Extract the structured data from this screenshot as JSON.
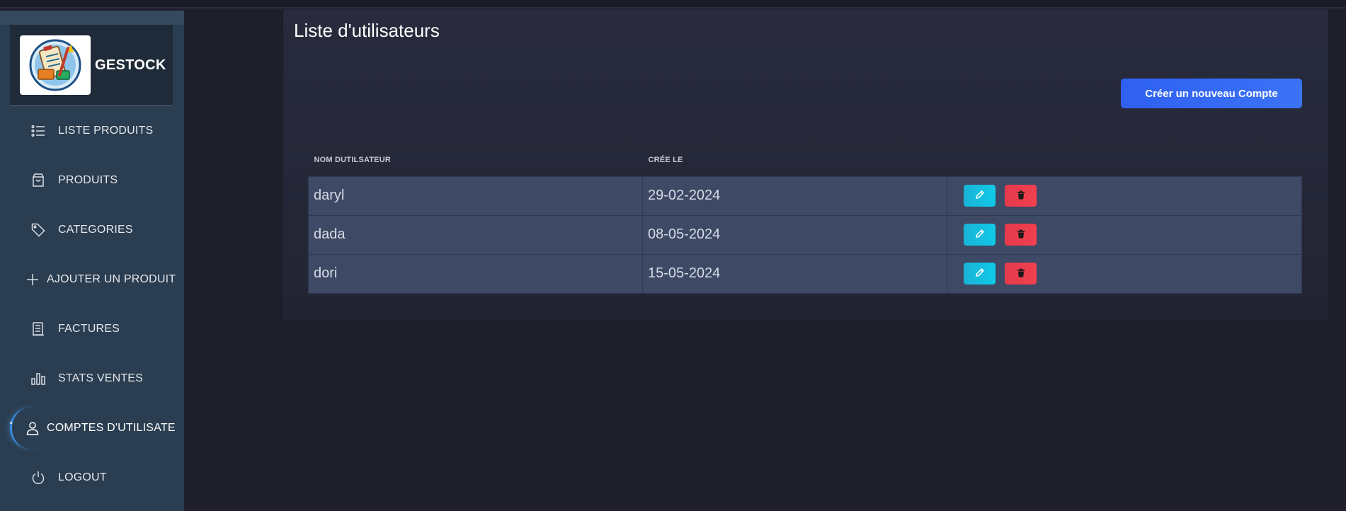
{
  "app": {
    "name": "GESTOCK"
  },
  "sidebar": {
    "items": [
      {
        "label": "LISTE PRODUITS",
        "icon": "list-icon"
      },
      {
        "label": "PRODUITS",
        "icon": "shopping-bag-icon"
      },
      {
        "label": "CATEGORIES",
        "icon": "tag-icon"
      },
      {
        "label": "AJOUTER UN PRODUIT",
        "icon": "plus-icon"
      },
      {
        "label": "FACTURES",
        "icon": "receipt-icon"
      },
      {
        "label": "STATS VENTES",
        "icon": "bar-chart-icon"
      },
      {
        "label": "COMPTES D'UTILISATE",
        "icon": "user-icon",
        "active": true
      },
      {
        "label": "LOGOUT",
        "icon": "power-icon"
      }
    ]
  },
  "main": {
    "title": "Liste d'utilisateurs",
    "create_button": "Créer un nouveau Compte",
    "table": {
      "headers": [
        "NOM DUTILSATEUR",
        "CRÉE LE",
        ""
      ],
      "rows": [
        {
          "username": "daryl",
          "created": "29-02-2024"
        },
        {
          "username": "dada",
          "created": "08-05-2024"
        },
        {
          "username": "dori",
          "created": "15-05-2024"
        }
      ]
    }
  },
  "colors": {
    "sidebar_bg": "#2b3d50",
    "page_bg": "#1e1f2a",
    "card_bg": "#282b3d",
    "primary_button": "#2f60f0",
    "edit_button": "#11c9e8",
    "delete_button": "#f2404f",
    "row_bg": "#3d4965"
  }
}
